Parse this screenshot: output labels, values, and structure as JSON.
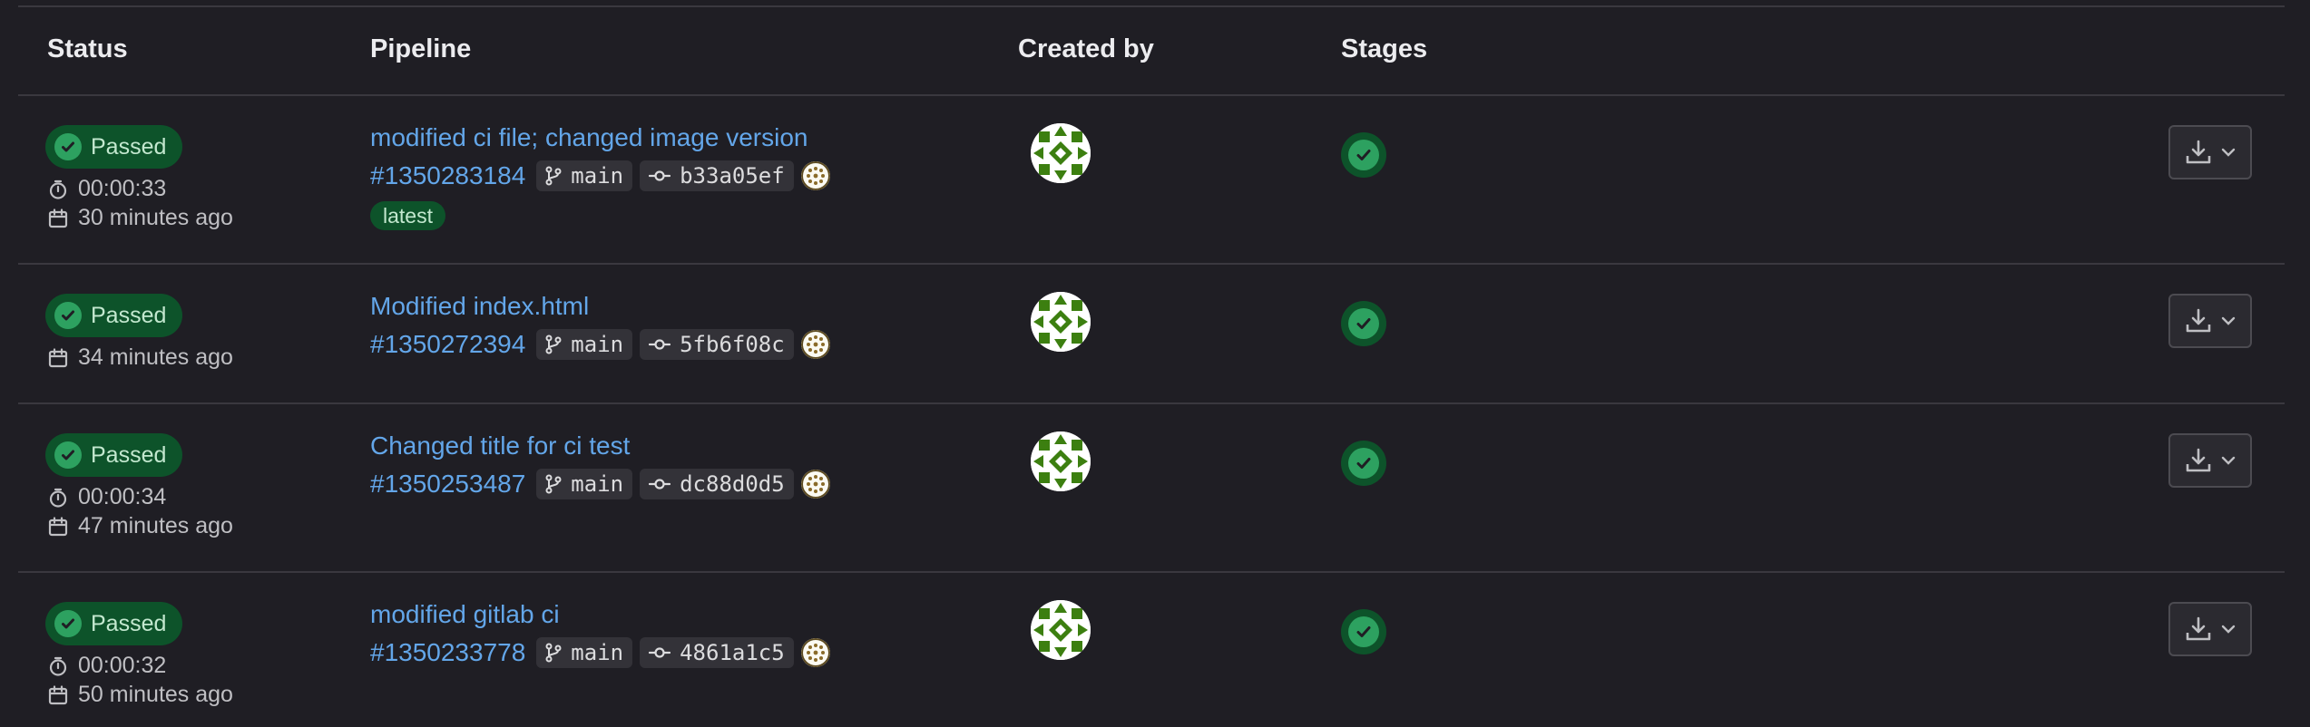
{
  "columns": {
    "status": "Status",
    "pipeline": "Pipeline",
    "created_by": "Created by",
    "stages": "Stages"
  },
  "rows": [
    {
      "status": "Passed",
      "duration": "00:00:33",
      "finished": "30 minutes ago",
      "title": "modified ci file; changed image version",
      "id": "#1350283184",
      "branch": "main",
      "commit": "b33a05ef",
      "tag": "latest",
      "stage_status": "passed"
    },
    {
      "status": "Passed",
      "finished": "34 minutes ago",
      "title": "Modified index.html",
      "id": "#1350272394",
      "branch": "main",
      "commit": "5fb6f08c",
      "stage_status": "passed"
    },
    {
      "status": "Passed",
      "duration": "00:00:34",
      "finished": "47 minutes ago",
      "title": "Changed title for ci test",
      "id": "#1350253487",
      "branch": "main",
      "commit": "dc88d0d5",
      "stage_status": "passed"
    },
    {
      "status": "Passed",
      "duration": "00:00:32",
      "finished": "50 minutes ago",
      "title": "modified gitlab ci",
      "id": "#1350233778",
      "branch": "main",
      "commit": "4861a1c5",
      "stage_status": "passed"
    }
  ],
  "icons": {
    "status": "check-circle-icon",
    "duration": "timer-icon",
    "finished": "calendar-icon",
    "branch": "branch-icon",
    "commit": "commit-icon",
    "artifacts": "download-icon",
    "dropdown": "chevron-down-icon"
  },
  "colors": {
    "background": "#1f1e24",
    "link": "#63a6e9",
    "success": "#2da160",
    "success_bg": "#0d532a",
    "avatar": "#3c7f10"
  }
}
